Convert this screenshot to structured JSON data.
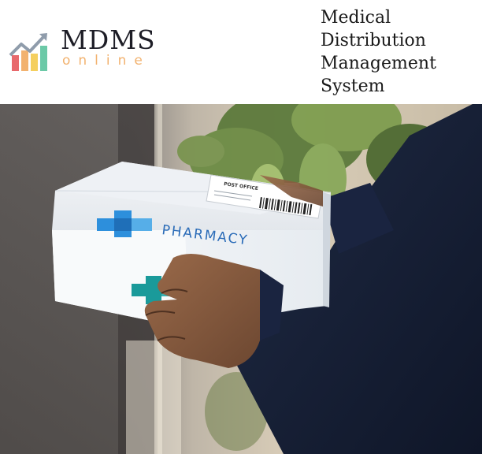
{
  "header": {
    "logo": {
      "icon": "bar-chart-growth-icon",
      "name": "MDMS",
      "sub": "online"
    },
    "title_lines": [
      "Medical",
      "Distribution",
      "Management",
      "System"
    ]
  },
  "hero": {
    "box_label": "PHARMACY",
    "shipping_label_header": "POST OFFICE",
    "icons": [
      "medical-cross-icon",
      "barcode-icon"
    ]
  },
  "colors": {
    "brand_text": "#1d1d26",
    "brand_sub": "#f2b26f",
    "cross_blue": "#2d8fdc",
    "cross_teal": "#1a9a9a",
    "sleeve_navy": "#141c33"
  }
}
